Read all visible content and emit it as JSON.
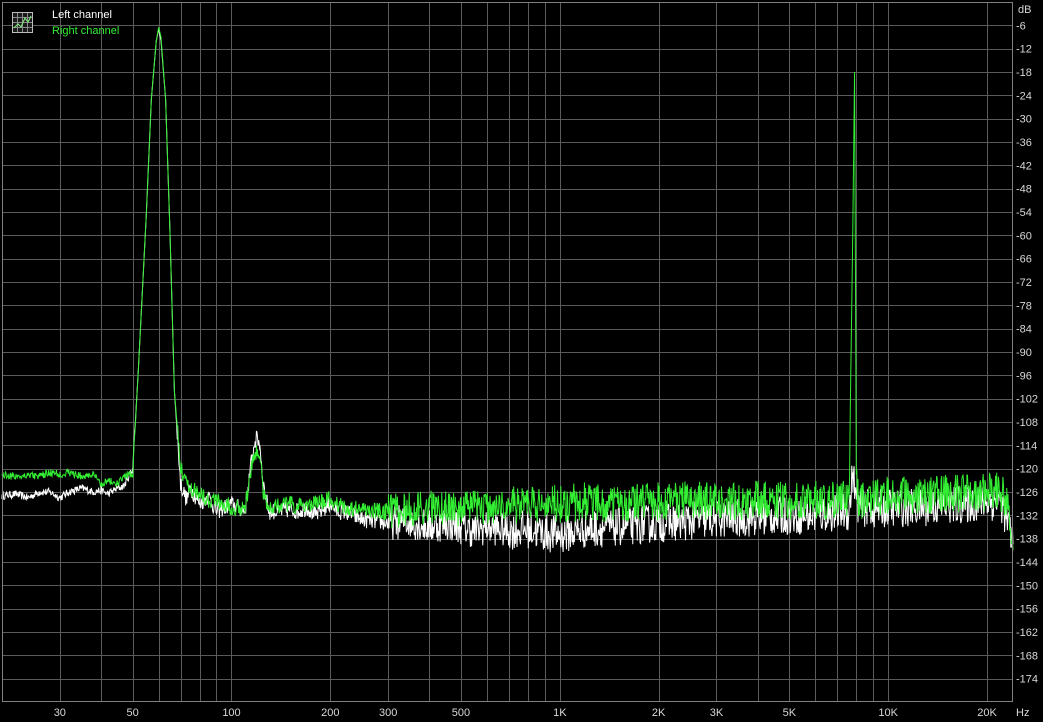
{
  "chart_data": {
    "type": "line",
    "title": "",
    "xlabel": "",
    "ylabel": "",
    "x_scale": "log",
    "x_unit_label": "Hz",
    "y_unit_label": "dB",
    "xlim": [
      20,
      24000
    ],
    "ylim": [
      -180,
      0
    ],
    "grid": true,
    "legend_position": "top-left",
    "colors": {
      "background": "#000000",
      "plot_background": "#000000",
      "grid": "#5a5a5a",
      "axis_text": "#d8d8d8",
      "frame": "#808080"
    },
    "legend_icon": "spectrum-window-icon",
    "x_tick_labels": [
      {
        "value": 30,
        "label": "30"
      },
      {
        "value": 50,
        "label": "50"
      },
      {
        "value": 100,
        "label": "100"
      },
      {
        "value": 200,
        "label": "200"
      },
      {
        "value": 300,
        "label": "300"
      },
      {
        "value": 500,
        "label": "500"
      },
      {
        "value": 1000,
        "label": "1K"
      },
      {
        "value": 2000,
        "label": "2K"
      },
      {
        "value": 3000,
        "label": "3K"
      },
      {
        "value": 5000,
        "label": "5K"
      },
      {
        "value": 10000,
        "label": "10K"
      },
      {
        "value": 20000,
        "label": "20K"
      }
    ],
    "y_tick_labels": [
      {
        "value": -6,
        "label": "-6"
      },
      {
        "value": -12,
        "label": "-12"
      },
      {
        "value": -18,
        "label": "-18"
      },
      {
        "value": -24,
        "label": "-24"
      },
      {
        "value": -30,
        "label": "-30"
      },
      {
        "value": -36,
        "label": "-36"
      },
      {
        "value": -42,
        "label": "-42"
      },
      {
        "value": -48,
        "label": "-48"
      },
      {
        "value": -54,
        "label": "-54"
      },
      {
        "value": -60,
        "label": "-60"
      },
      {
        "value": -66,
        "label": "-66"
      },
      {
        "value": -72,
        "label": "-72"
      },
      {
        "value": -78,
        "label": "-78"
      },
      {
        "value": -84,
        "label": "-84"
      },
      {
        "value": -90,
        "label": "-90"
      },
      {
        "value": -96,
        "label": "-96"
      },
      {
        "value": -102,
        "label": "-102"
      },
      {
        "value": -108,
        "label": "-108"
      },
      {
        "value": -114,
        "label": "-114"
      },
      {
        "value": -120,
        "label": "-120"
      },
      {
        "value": -126,
        "label": "-126"
      },
      {
        "value": -132,
        "label": "-132"
      },
      {
        "value": -138,
        "label": "-138"
      },
      {
        "value": -144,
        "label": "-144"
      },
      {
        "value": -150,
        "label": "-150"
      },
      {
        "value": -156,
        "label": "-156"
      },
      {
        "value": -162,
        "label": "-162"
      },
      {
        "value": -168,
        "label": "-168"
      },
      {
        "value": -174,
        "label": "-174"
      }
    ],
    "series": [
      {
        "name": "Left channel",
        "color": "#ffffff",
        "x": [
          20,
          22,
          24,
          26,
          28,
          30,
          32,
          35,
          38,
          40,
          42,
          45,
          47,
          50,
          52,
          55,
          57,
          59,
          60,
          61,
          63,
          65,
          67,
          70,
          73,
          75,
          80,
          85,
          90,
          95,
          100,
          105,
          110,
          115,
          118,
          120,
          122,
          125,
          130,
          140,
          150,
          160,
          170,
          180,
          190,
          200,
          210,
          220,
          250,
          300,
          350,
          400,
          450,
          500,
          550,
          600,
          700,
          800,
          900,
          1000,
          1200,
          1500,
          2000,
          2500,
          3000,
          4000,
          5000,
          6000,
          7000,
          7600,
          7800,
          8000,
          8200,
          8500,
          9000,
          10000,
          12000,
          15000,
          18000,
          20000,
          22000,
          23000,
          24000
        ],
        "y": [
          -127,
          -126.5,
          -127.5,
          -126,
          -126,
          -127.5,
          -126,
          -125,
          -126,
          -125.5,
          -126.5,
          -125,
          -124.5,
          -120,
          -95,
          -55,
          -25,
          -10,
          -7,
          -10,
          -25,
          -60,
          -100,
          -124,
          -128,
          -125,
          -129,
          -127,
          -131,
          -130,
          -129,
          -130,
          -131,
          -118,
          -113,
          -112,
          -114,
          -124,
          -131,
          -131,
          -130.5,
          -131,
          -130,
          -132,
          -130.5,
          -129,
          -131,
          -131,
          -133,
          -134,
          -133.5,
          -135,
          -134,
          -135,
          -136,
          -135,
          -136,
          -135.5,
          -136.5,
          -137,
          -135.5,
          -135,
          -134,
          -133.5,
          -133,
          -132.5,
          -132,
          -132,
          -131,
          -131,
          -121,
          -128,
          -130,
          -130,
          -130.5,
          -130,
          -130,
          -129.5,
          -129,
          -128.5,
          -128.5,
          -133,
          -139
        ]
      },
      {
        "name": "Right channel",
        "color": "#33ee33",
        "x": [
          20,
          22,
          24,
          26,
          28,
          30,
          32,
          35,
          38,
          40,
          42,
          45,
          47,
          50,
          52,
          55,
          57,
          59,
          60,
          61,
          63,
          65,
          67,
          70,
          73,
          75,
          80,
          85,
          90,
          95,
          100,
          105,
          110,
          115,
          118,
          120,
          122,
          125,
          130,
          140,
          150,
          160,
          170,
          180,
          190,
          200,
          210,
          220,
          250,
          300,
          350,
          400,
          450,
          500,
          550,
          600,
          700,
          800,
          900,
          1000,
          1200,
          1500,
          2000,
          2500,
          3000,
          4000,
          5000,
          6000,
          7000,
          7600,
          7800,
          7900,
          8000,
          8100,
          8200,
          8500,
          9000,
          10000,
          12000,
          15000,
          18000,
          20000,
          22000,
          23000,
          24000
        ],
        "y": [
          -121.5,
          -122,
          -121.5,
          -122,
          -121,
          -121.5,
          -121,
          -122,
          -121.5,
          -124,
          -123,
          -124,
          -122,
          -121.5,
          -95,
          -55,
          -25,
          -10,
          -6.5,
          -9,
          -25,
          -60,
          -100,
          -120,
          -123,
          -125,
          -126,
          -128,
          -128,
          -129,
          -130,
          -130,
          -130,
          -120,
          -116,
          -115,
          -117,
          -126,
          -130,
          -129.5,
          -129,
          -130,
          -129,
          -129,
          -128.5,
          -128,
          -129,
          -130,
          -130.5,
          -131,
          -130.5,
          -130,
          -130,
          -130.5,
          -130,
          -130,
          -129.5,
          -129,
          -129,
          -129,
          -128.5,
          -129,
          -128.5,
          -128,
          -128.5,
          -128,
          -128.5,
          -128,
          -128,
          -128,
          -60,
          -18,
          -120,
          -127,
          -128,
          -128,
          -127.5,
          -127,
          -127,
          -126.5,
          -126.5,
          -126,
          -126,
          -129,
          -140
        ]
      }
    ]
  }
}
